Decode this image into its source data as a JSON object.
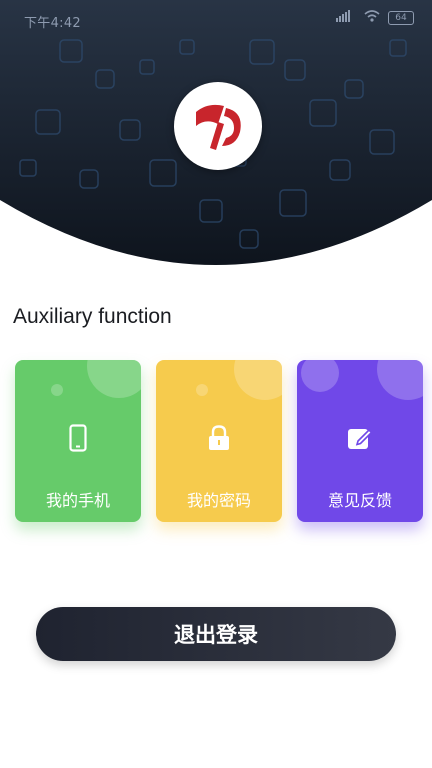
{
  "status_bar": {
    "time": "下午4:42",
    "battery": "64",
    "icons": [
      "alarm-icon",
      "signal-icon",
      "wifi-icon",
      "battery-icon"
    ]
  },
  "header": {
    "logo": "brand-logo",
    "colors": {
      "background_top": "#263241",
      "background_bottom": "#0f1620",
      "logo_red": "#c8252c"
    }
  },
  "section": {
    "title": "Auxiliary function"
  },
  "cards": [
    {
      "label": "我的手机",
      "icon": "phone-icon",
      "color": "#66cb6a"
    },
    {
      "label": "我的密码",
      "icon": "lock-icon",
      "color": "#f6cb4d"
    },
    {
      "label": "意见反馈",
      "icon": "edit-icon",
      "color": "#7048e8"
    }
  ],
  "logout": {
    "label": "退出登录"
  }
}
